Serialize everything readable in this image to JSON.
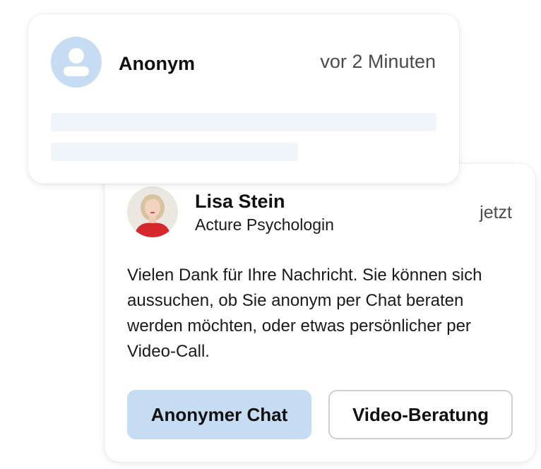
{
  "anonymous_message": {
    "avatar_icon": "user-icon",
    "sender": "Anonym",
    "time": "vor 2 Minuten"
  },
  "reply": {
    "avatar": "psychologist-photo",
    "name": "Lisa Stein",
    "role": "Acture Psychologin",
    "time": "jetzt",
    "message": "Vielen Dank für Ihre Nachricht. Sie können sich aussuchen, ob Sie anonym per Chat beraten werden möchten, oder etwas persönlicher per Video-Call.",
    "actions": {
      "chat_label": "Anonymer Chat",
      "video_label": "Video-Beratung"
    }
  },
  "colors": {
    "accent": "#c6dcf2",
    "skeleton": "#f0f5fb",
    "text": "#111111",
    "muted": "#4b4b4b"
  }
}
